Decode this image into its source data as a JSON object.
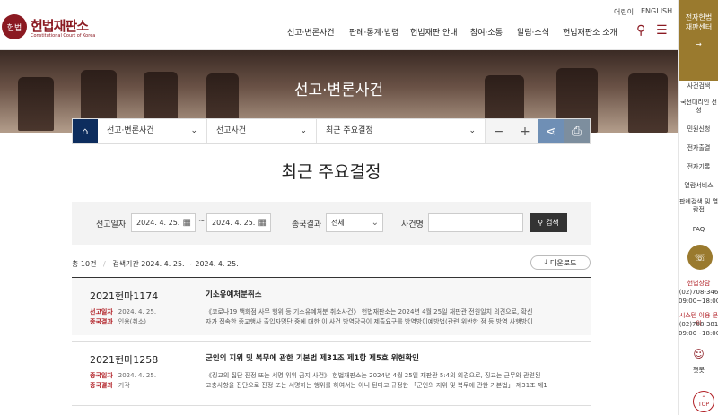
{
  "header": {
    "logo_mark": "헌법",
    "logo_text": "헌법재판소",
    "logo_sub": "Constitutional Court of Korea",
    "util_links": [
      "어린이",
      "ENGLISH"
    ],
    "nav": [
      "선고·변론사건",
      "판례·통계·법령",
      "헌법재판 안내",
      "참여·소통",
      "알림·소식",
      "헌법재판소 소개"
    ],
    "search_icon_label": "⚲",
    "menu_icon_label": "☰"
  },
  "hero": {
    "title": "선고·변론사건"
  },
  "breadcrumb": {
    "home_label": "⌂",
    "level1": "선고·변론사건",
    "level2": "선고사건",
    "level3": "최근 주요결정",
    "minus": "−",
    "plus": "+",
    "share": "⋖",
    "print": "⎙"
  },
  "page_title": "최근 주요결정",
  "search": {
    "date_label": "선고일자",
    "date_from": "2024. 4. 25.",
    "date_sep": "~",
    "date_to": "2024. 4. 25.",
    "result_label": "종국결과",
    "result_value": "전체",
    "case_label": "사건명",
    "case_placeholder": "",
    "button_label": "검색"
  },
  "meta": {
    "count": "총 10건",
    "period": "검색기간 2024. 4. 25. ~ 2024. 4. 25.",
    "download": "다운로드"
  },
  "rows": [
    {
      "case_no": "2021헌마1174",
      "k1": "선고일자",
      "v1": "2024. 4. 25.",
      "k2": "종국결과",
      "v2": "인용(취소)",
      "title": "기소유예처분취소",
      "desc1": "《코로나19 백화점 사무 행위 등 기소유예처분 취소사건》 헌법재판소는 2024년 4월 25일 재판관 전원일치 의견으로, 확신",
      "desc2": "자가 접속한 종교행사 출입자명단 중에 대한 이 사건 방역당국이 제출요구를 방역방이예방법(관련 위반한 점 등 방역 사행방이"
    },
    {
      "case_no": "2021헌마1258",
      "k1": "종국일자",
      "v1": "2024. 4. 25.",
      "k2": "종국결과",
      "v2": "기각",
      "title": "군인의 지위 및 복무에 관한 기본법 제31조 제1항 제5호 위헌확인",
      "desc1": "《징교의 집단 진정 또는 서명 위위 금지 사건》 헌법재판소는 2024년 4월 25일 재판관 5:4의 의견으로, 징교는 근무와 관련된",
      "desc2": "고충사항을 진단으로 진정 또는 서명하는 행위를 하여서는 아니 된다고 규정한 「군인의 지위 및 복무에 관한 기본법」 제31조 제1"
    }
  ],
  "sidebar": {
    "top_title": "전자헌법 재판센터",
    "items": [
      "사건검색",
      "국선대리인 선청",
      "민원신청",
      "전자출결",
      "전자기록",
      "열람서비스",
      "판례검색 및 열람접",
      "FAQ"
    ],
    "call_label": "헌법상담",
    "call_no": "(02)708-346",
    "call_hours": "09:00~18:00",
    "sys_label": "시스템 이용 문의",
    "sys_no": "(02)708-381",
    "sys_hours": "09:00~18:00",
    "chat_label": "챗봇",
    "top_label": "TOP",
    "top_arrow": "⌃"
  }
}
